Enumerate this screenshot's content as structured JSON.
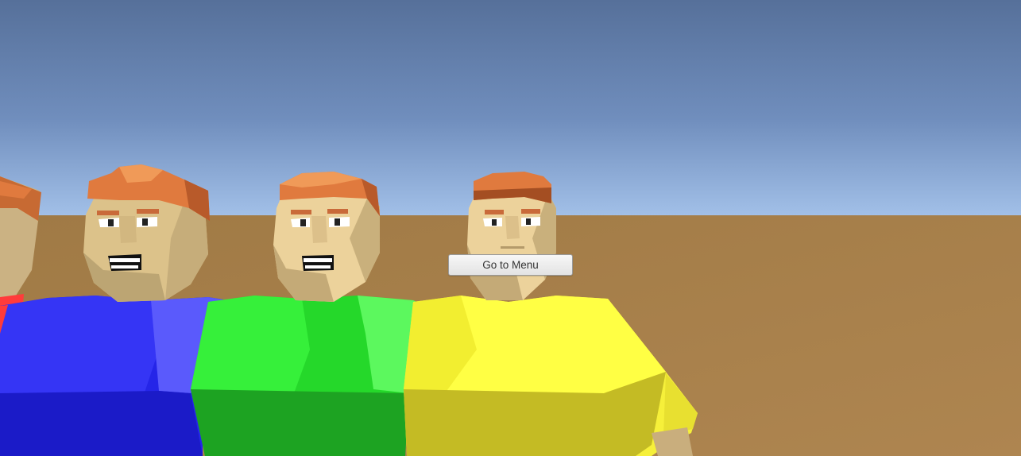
{
  "ui": {
    "menu_button_label": "Go to Menu"
  },
  "scene": {
    "characters": [
      {
        "name": "red-shirt-character",
        "shirt_color": "#ff3b3b",
        "partially_visible": true
      },
      {
        "name": "blue-shirt-character",
        "shirt_color": "#2a2af0",
        "expression": "smiling"
      },
      {
        "name": "green-shirt-character",
        "shirt_color": "#22e02a",
        "expression": "smiling"
      },
      {
        "name": "yellow-shirt-character",
        "shirt_color": "#ffff3a",
        "expression": "neutral"
      }
    ],
    "colors": {
      "sky_top": "#58709a",
      "sky_horizon": "#9fbde6",
      "ground": "#a6804a",
      "hair": "#e07a3e",
      "skin": "#ddc38c"
    }
  }
}
